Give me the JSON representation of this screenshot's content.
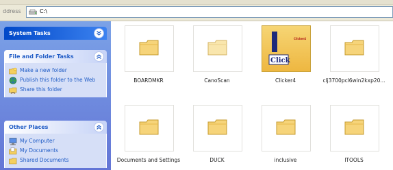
{
  "address": {
    "label": "ddress",
    "path": "C:\\"
  },
  "taskpane": {
    "system_tasks": {
      "title": "System Tasks"
    },
    "file_folder_tasks": {
      "title": "File and Folder Tasks",
      "items": [
        {
          "label": "Make a new folder",
          "icon": "new-folder-icon"
        },
        {
          "label": "Publish this folder to the Web",
          "icon": "publish-web-icon"
        },
        {
          "label": "Share this folder",
          "icon": "share-folder-icon"
        }
      ]
    },
    "other_places": {
      "title": "Other Places",
      "items": [
        {
          "label": "My Computer",
          "icon": "my-computer-icon"
        },
        {
          "label": "My Documents",
          "icon": "my-documents-icon"
        },
        {
          "label": "Shared Documents",
          "icon": "shared-documents-icon"
        }
      ]
    }
  },
  "folders": [
    {
      "name": "BOARDMKR"
    },
    {
      "name": "CanoScan"
    },
    {
      "name": "Clicker4",
      "thumbnail_text": "Click",
      "thumbnail_badge": "Clicker4"
    },
    {
      "name": "clj3700pcl6win2kxp20..."
    },
    {
      "name": "Documents and Settings"
    },
    {
      "name": "DUCK"
    },
    {
      "name": "inclusive"
    },
    {
      "name": "ITOOLS"
    }
  ],
  "colors": {
    "folder_fill": "#f6d47a",
    "link_blue": "#215dc6",
    "header_blue": "#0048c8"
  }
}
